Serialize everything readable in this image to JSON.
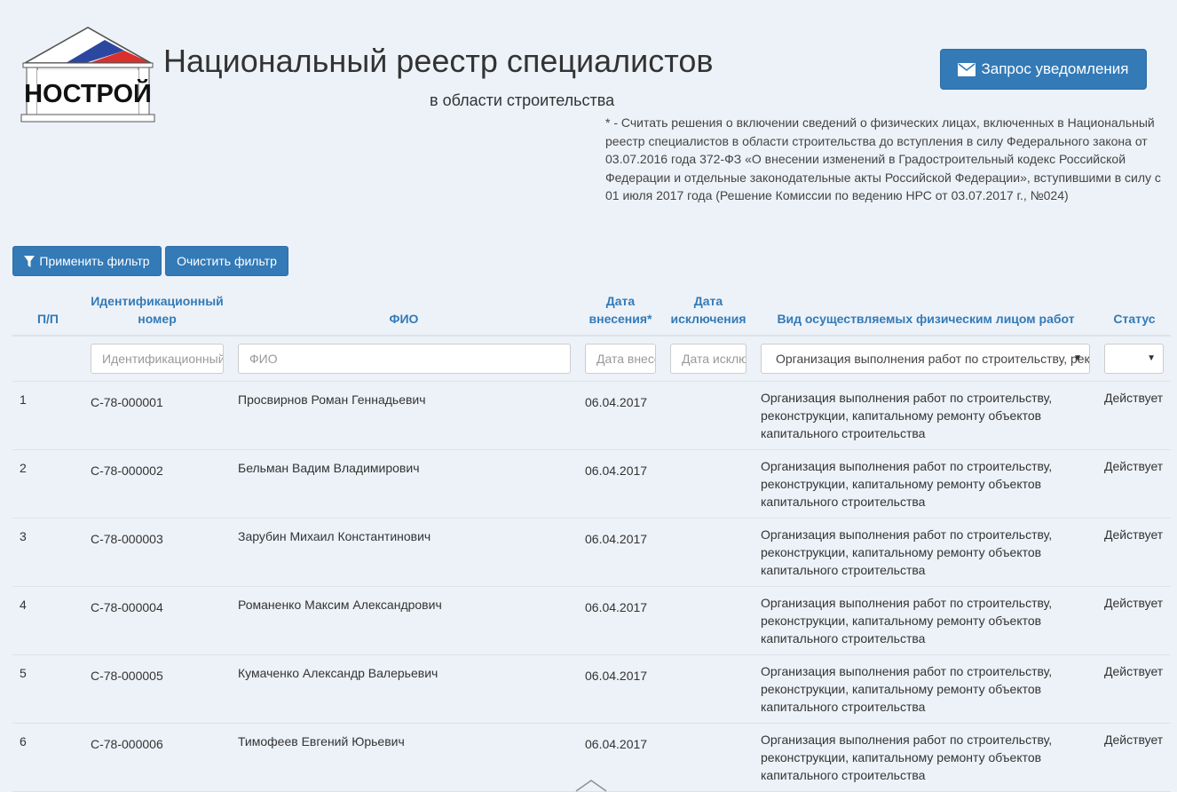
{
  "header": {
    "logo_text": "НОСТРОЙ",
    "title": "Национальный реестр специалистов",
    "subtitle": "в области строительства",
    "note": "* - Считать решения о включении сведений о физических лицах, включенных в Национальный реестр специалистов в области строительства до вступления в силу Федерального закона от 03.07.2016 года 372-ФЗ «О внесении изменений в Градостроительный кодекс Российской Федерации и отдельные законодательные акты Российской Федерации», вступившими в силу с 01 июля 2017 года (Решение Комиссии по ведению НРС от 03.07.2017 г., №024)",
    "notify_button": "Запрос уведомления"
  },
  "filters": {
    "apply": "Применить фильтр",
    "clear": "Очистить фильтр"
  },
  "table": {
    "headers": {
      "num": "П/П",
      "id_line1": "Идентификационный",
      "id_line2": "номер",
      "fio": "ФИО",
      "date_in_line1": "Дата",
      "date_in_line2": "внесения*",
      "date_out_line1": "Дата",
      "date_out_line2": "исключения",
      "work": "Вид осуществляемых физическим лицом работ",
      "status": "Статус"
    },
    "filter_inputs": {
      "id_placeholder": "Идентификационный номер",
      "fio_placeholder": "ФИО",
      "date_in_placeholder": "Дата внесения",
      "date_out_placeholder": "Дата исключения",
      "work_selected": "Организация выполнения работ по строительству, реконструкции, капитальному ремонту объектов капитального строительства",
      "status_selected": ""
    },
    "rows": [
      {
        "num": "1",
        "id": "С-78-000001",
        "fio": "Просвирнов Роман Геннадьевич",
        "date_in": "06.04.2017",
        "date_out": "",
        "work": "Организация выполнения работ по строительству, реконструкции, капитальному ремонту объектов капитального строительства",
        "status": "Действует"
      },
      {
        "num": "2",
        "id": "С-78-000002",
        "fio": "Бельман Вадим Владимирович",
        "date_in": "06.04.2017",
        "date_out": "",
        "work": "Организация выполнения работ по строительству, реконструкции, капитальному ремонту объектов капитального строительства",
        "status": "Действует"
      },
      {
        "num": "3",
        "id": "С-78-000003",
        "fio": "Зарубин Михаил Константинович",
        "date_in": "06.04.2017",
        "date_out": "",
        "work": "Организация выполнения работ по строительству, реконструкции, капитальному ремонту объектов капитального строительства",
        "status": "Действует"
      },
      {
        "num": "4",
        "id": "С-78-000004",
        "fio": "Романенко Максим Александрович",
        "date_in": "06.04.2017",
        "date_out": "",
        "work": "Организация выполнения работ по строительству, реконструкции, капитальному ремонту объектов капитального строительства",
        "status": "Действует"
      },
      {
        "num": "5",
        "id": "С-78-000005",
        "fio": "Кумаченко Александр Валерьевич",
        "date_in": "06.04.2017",
        "date_out": "",
        "work": "Организация выполнения работ по строительству, реконструкции, капитальному ремонту объектов капитального строительства",
        "status": "Действует"
      },
      {
        "num": "6",
        "id": "С-78-000006",
        "fio": "Тимофеев Евгений Юрьевич",
        "date_in": "06.04.2017",
        "date_out": "",
        "work": "Организация выполнения работ по строительству, реконструкции, капитальному ремонту объектов капитального строительства",
        "status": "Действует"
      }
    ]
  },
  "icons": {
    "notify": "envelope-icon",
    "apply": "filter-icon",
    "select": "caret-down-icon",
    "scroll": "chevron-up-icon"
  },
  "colors": {
    "accent": "#337ab7",
    "background": "#edf2f8"
  }
}
